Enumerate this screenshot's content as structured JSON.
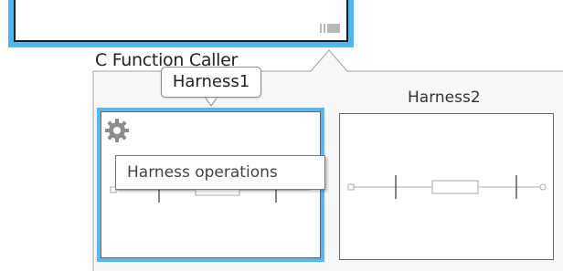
{
  "caller_block": {
    "name": "C Function Caller"
  },
  "harness_popup": {
    "harnesses": [
      {
        "label": "Harness1",
        "selected": true
      },
      {
        "label": "Harness2",
        "selected": false
      }
    ],
    "tooltip": "Harness operations"
  },
  "colors": {
    "selection_blue": "#4db8ef",
    "border_gray": "#666666",
    "text": "#222222"
  },
  "icons": {
    "harness_badge": "harness-badge-icon",
    "operations": "gear-icon"
  }
}
